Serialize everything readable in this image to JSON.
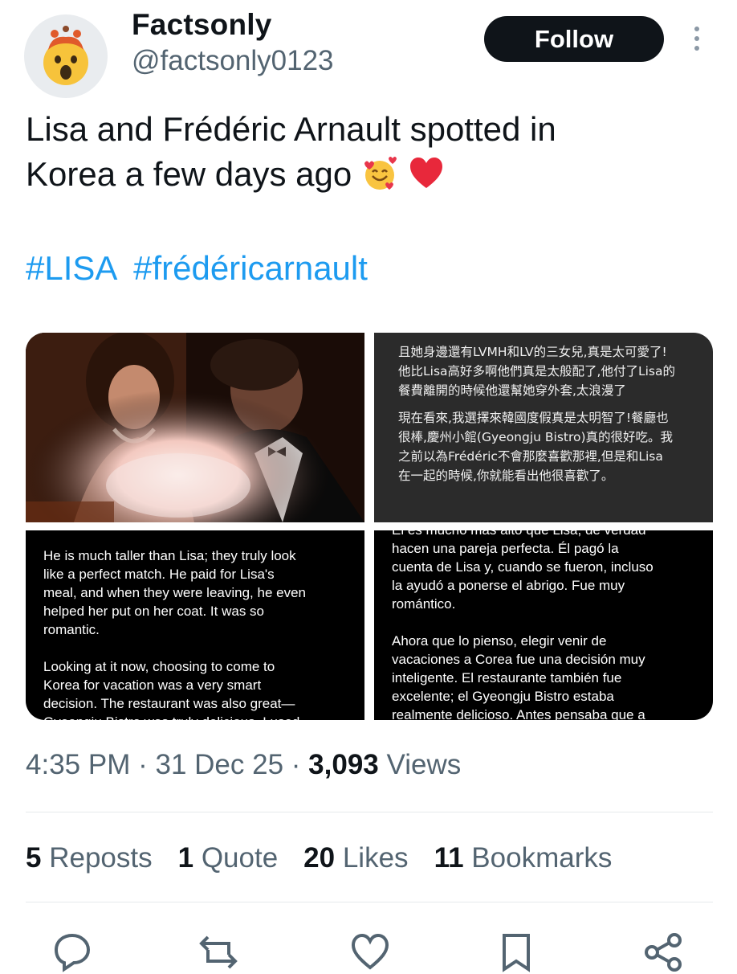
{
  "author": {
    "display_name": "Factsonly",
    "handle": "@factsonly0123",
    "avatar_icon": "mind-blown-emoji"
  },
  "follow_label": "Follow",
  "more_icon": "more-vertical-icon",
  "tweet": {
    "text_line1": "Lisa and Frédéric Arnault spotted in",
    "text_line2": "Korea a few days ago",
    "emojis": [
      "smiling-face-with-hearts-emoji",
      "red-heart-emoji"
    ],
    "hashtags": [
      "#LISA",
      "#frédéricarnault"
    ]
  },
  "media": {
    "photo_icon": "photo",
    "zh_paragraphs": [
      "且她身邊還有LVMH和LV的三女兒,真是太可愛了!\n他比Lisa高好多啊他們真是太般配了,他付了Lisa的\n餐費離開的時候他還幫她穿外套,太浪漫了",
      "現在看來,我選擇來韓國度假真是太明智了!餐廳也\n很棒,慶州小館(Gyeongju Bistro)真的很好吃。我\n之前以為Frédéric不會那麼喜歡那裡,但是和Lisa\n在一起的時候,你就能看出他很喜歡了。"
    ],
    "en_paragraphs": [
      "He is much taller than Lisa; they truly look\nlike a perfect match. He paid for Lisa's\nmeal, and when they were leaving, he even\nhelped her put on her coat. It was so\nromantic.",
      "Looking at it now, choosing to come to\nKorea for vacation was a very smart\ndecision. The restaurant was also great—\nGyeongju Bistro was truly delicious. I used"
    ],
    "es_paragraphs": [
      "Él es mucho más alto que Lisa, de verdad\nhacen una pareja perfecta. Él pagó la\ncuenta de Lisa y, cuando se fueron, incluso\nla ayudó a ponerse el abrigo. Fue muy\nromántico.",
      "Ahora que lo pienso, elegir venir de\nvacaciones a Corea fue una decisión muy\ninteligente. El restaurante también fue\nexcelente; el Gyeongju Bistro estaba\nrealmente delicioso. Antes pensaba que a"
    ]
  },
  "meta": {
    "time": "4:35 PM",
    "sep": "·",
    "date": "31 Dec 25",
    "views_count": "3,093",
    "views_label": "Views"
  },
  "stats": {
    "reposts_count": "5",
    "reposts_label": "Reposts",
    "quotes_count": "1",
    "quotes_label": "Quote",
    "likes_count": "20",
    "likes_label": "Likes",
    "bookmarks_count": "11",
    "bookmarks_label": "Bookmarks"
  },
  "actions": [
    "reply-icon",
    "repost-icon",
    "like-icon",
    "bookmark-icon",
    "share-icon"
  ],
  "colors": {
    "link": "#1d9bf0",
    "muted": "#536471",
    "text": "#0f1419",
    "button": "#0f1419"
  }
}
